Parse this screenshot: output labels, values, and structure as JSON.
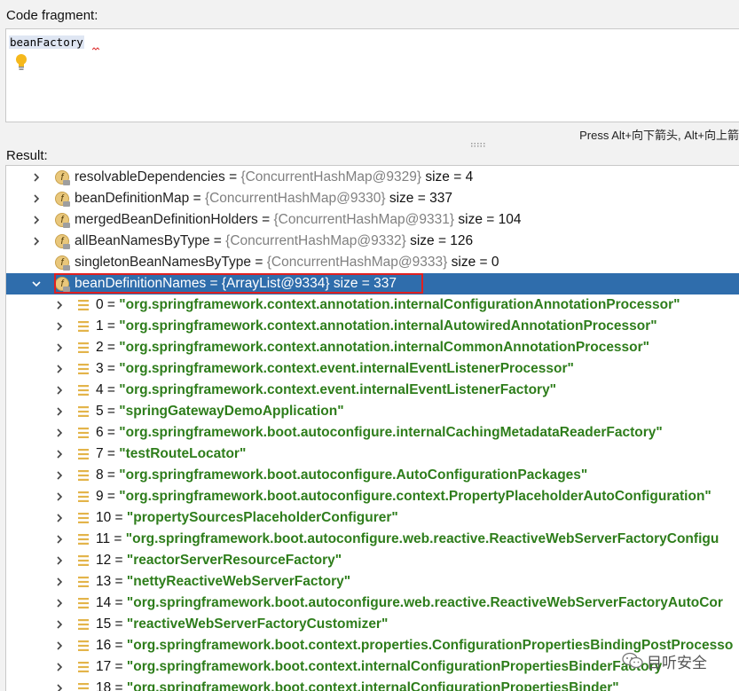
{
  "code_fragment": {
    "label": "Code fragment:",
    "code": "beanFactory",
    "hint": "Press Alt+向下箭头, Alt+向上箭"
  },
  "result": {
    "label": "Result:",
    "fields": [
      {
        "name": "resolvableDependencies",
        "ref": "{ConcurrentHashMap@9329}",
        "size": "size = 4",
        "expandable": true
      },
      {
        "name": "beanDefinitionMap",
        "ref": "{ConcurrentHashMap@9330}",
        "size": "size = 337",
        "expandable": true
      },
      {
        "name": "mergedBeanDefinitionHolders",
        "ref": "{ConcurrentHashMap@9331}",
        "size": "size = 104",
        "expandable": true
      },
      {
        "name": "allBeanNamesByType",
        "ref": "{ConcurrentHashMap@9332}",
        "size": "size = 126",
        "expandable": true
      },
      {
        "name": "singletonBeanNamesByType",
        "ref": "{ConcurrentHashMap@9333}",
        "size": "size = 0",
        "expandable": false
      },
      {
        "name": "beanDefinitionNames",
        "ref": "{ArrayList@9334}",
        "size": "size = 337",
        "expandable": true,
        "expanded": true,
        "selected": true
      }
    ],
    "items": [
      {
        "index": "0",
        "value": "\"org.springframework.context.annotation.internalConfigurationAnnotationProcessor\""
      },
      {
        "index": "1",
        "value": "\"org.springframework.context.annotation.internalAutowiredAnnotationProcessor\""
      },
      {
        "index": "2",
        "value": "\"org.springframework.context.annotation.internalCommonAnnotationProcessor\""
      },
      {
        "index": "3",
        "value": "\"org.springframework.context.event.internalEventListenerProcessor\""
      },
      {
        "index": "4",
        "value": "\"org.springframework.context.event.internalEventListenerFactory\""
      },
      {
        "index": "5",
        "value": "\"springGatewayDemoApplication\""
      },
      {
        "index": "6",
        "value": "\"org.springframework.boot.autoconfigure.internalCachingMetadataReaderFactory\""
      },
      {
        "index": "7",
        "value": "\"testRouteLocator\""
      },
      {
        "index": "8",
        "value": "\"org.springframework.boot.autoconfigure.AutoConfigurationPackages\""
      },
      {
        "index": "9",
        "value": "\"org.springframework.boot.autoconfigure.context.PropertyPlaceholderAutoConfiguration\""
      },
      {
        "index": "10",
        "value": "\"propertySourcesPlaceholderConfigurer\""
      },
      {
        "index": "11",
        "value": "\"org.springframework.boot.autoconfigure.web.reactive.ReactiveWebServerFactoryConfigu"
      },
      {
        "index": "12",
        "value": "\"reactorServerResourceFactory\""
      },
      {
        "index": "13",
        "value": "\"nettyReactiveWebServerFactory\""
      },
      {
        "index": "14",
        "value": "\"org.springframework.boot.autoconfigure.web.reactive.ReactiveWebServerFactoryAutoCor"
      },
      {
        "index": "15",
        "value": "\"reactiveWebServerFactoryCustomizer\""
      },
      {
        "index": "16",
        "value": "\"org.springframework.boot.context.properties.ConfigurationPropertiesBindingPostProcesso"
      },
      {
        "index": "17",
        "value": "\"org.springframework.boot.context.internalConfigurationPropertiesBinderFactory"
      },
      {
        "index": "18",
        "value": "\"org.springframework.boot.context.internalConfigurationPropertiesBinder\""
      }
    ]
  },
  "watermark": {
    "text": "目听安全"
  },
  "colors": {
    "selection": "#2f6dac",
    "string_value": "#2e7d1b",
    "highlight_box": "#e02020"
  }
}
